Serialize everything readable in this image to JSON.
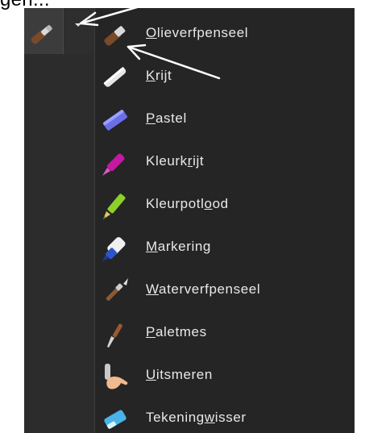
{
  "page_top_text": "gen...",
  "toolbar": {
    "current_tool_icon": "oil-brush-icon",
    "dropdown_icon": "chevron-down-icon"
  },
  "menu": {
    "items": [
      {
        "label_pre": "",
        "label_key": "O",
        "label_post": "lieverfpenseel",
        "icon": "oil-brush-icon"
      },
      {
        "label_pre": "",
        "label_key": "K",
        "label_post": "rijt",
        "icon": "chalk-icon"
      },
      {
        "label_pre": "",
        "label_key": "P",
        "label_post": "astel",
        "icon": "pastel-icon"
      },
      {
        "label_pre": "Kleurk",
        "label_key": "r",
        "label_post": "ijt",
        "icon": "crayon-icon"
      },
      {
        "label_pre": "Kleurpotl",
        "label_key": "o",
        "label_post": "od",
        "icon": "colored-pencil-icon"
      },
      {
        "label_pre": "",
        "label_key": "M",
        "label_post": "arkering",
        "icon": "marker-icon"
      },
      {
        "label_pre": "",
        "label_key": "W",
        "label_post": "aterverfpenseel",
        "icon": "watercolor-brush-icon"
      },
      {
        "label_pre": "",
        "label_key": "P",
        "label_post": "aletmes",
        "icon": "palette-knife-icon"
      },
      {
        "label_pre": "",
        "label_key": "U",
        "label_post": "itsmeren",
        "icon": "smudge-icon"
      },
      {
        "label_pre": "Tekening",
        "label_key": "w",
        "label_post": "isser",
        "icon": "eraser-icon"
      }
    ]
  },
  "annotations": {
    "arrow_color": "#ffffff",
    "arrows": [
      "arrow-to-dropdown",
      "arrow-to-first-item"
    ]
  }
}
